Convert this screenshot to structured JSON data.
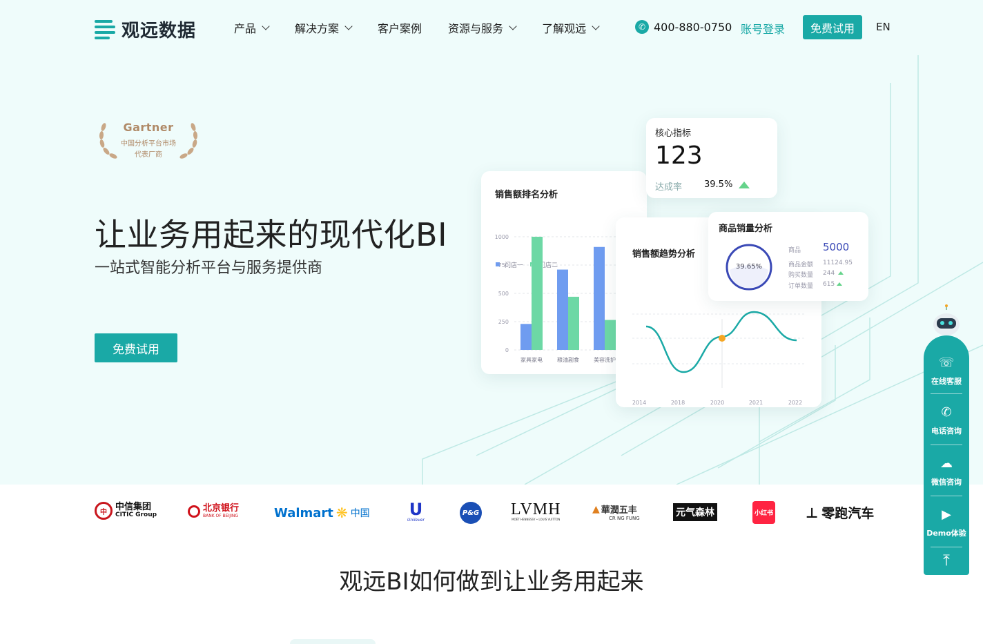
{
  "header": {
    "brand": "观远数据",
    "nav": [
      {
        "label": "产品",
        "has_dropdown": true
      },
      {
        "label": "解决方案",
        "has_dropdown": true
      },
      {
        "label": "客户案例",
        "has_dropdown": false
      },
      {
        "label": "资源与服务",
        "has_dropdown": true
      },
      {
        "label": "了解观远",
        "has_dropdown": true
      }
    ],
    "phone": "400-880-0750",
    "login": "账号登录",
    "trial": "免费试用",
    "lang": "EN"
  },
  "hero": {
    "badge": {
      "line1": "Gartner",
      "line2": "中国分析平台市场",
      "line3": "代表厂商"
    },
    "title": "让业务用起来的现代化BI",
    "subtitle": "一站式智能分析平台与服务提供商",
    "cta": "免费试用"
  },
  "colors": {
    "accent": "#1aa9a6",
    "bar_blue": "#6f9cf0",
    "bar_green": "#6dd8a5",
    "line": "#1aa9a6",
    "marker": "#f5a623",
    "ring": "#3a49b6",
    "up": "#65d38a"
  },
  "kpi_card": {
    "title": "核心指标",
    "value": "123",
    "rate_label": "达成率",
    "rate_value": "39.5%"
  },
  "sales_card": {
    "title": "商品销量分析",
    "ring_percent": "39.65%",
    "ring_fraction": 0.3965,
    "rows": [
      {
        "label": "商品",
        "value": "5000"
      },
      {
        "label": "商品金额",
        "value": "11124.95"
      },
      {
        "label": "购买数量",
        "value": "244"
      },
      {
        "label": "订单数量",
        "value": "615"
      }
    ]
  },
  "chart_data": [
    {
      "type": "bar",
      "title": "销售额排名分析",
      "categories": [
        "家具家电",
        "粮油副食",
        "美容洗护"
      ],
      "series": [
        {
          "name": "门店一",
          "values": [
            230,
            710,
            910
          ]
        },
        {
          "name": "门店二",
          "values": [
            1000,
            470,
            265
          ]
        }
      ],
      "ylim": [
        0,
        1000
      ],
      "yticks": [
        "0",
        "250",
        "500",
        "750",
        "1000"
      ],
      "grid": true,
      "legend": "top-left"
    },
    {
      "type": "line",
      "title": "销售额趋势分析",
      "x": [
        "2014",
        "2018",
        "2020",
        "2021",
        "2022"
      ],
      "series": [
        {
          "values": [
            0.65,
            0.05,
            0.6,
            0.9,
            0.6
          ]
        }
      ],
      "highlight_index": 2,
      "grid": true
    }
  ],
  "logos": [
    {
      "name": "citic",
      "text1": "中信集团",
      "text2": "CITIC Group"
    },
    {
      "name": "bank-of-beijing",
      "text1": "北京银行",
      "text2": "BANK OF BEIJING"
    },
    {
      "name": "walmart",
      "text1": "Walmart",
      "text2": "中国"
    },
    {
      "name": "unilever",
      "text1": "Unilever"
    },
    {
      "name": "pg",
      "text1": "P&G"
    },
    {
      "name": "lvmh",
      "text1": "LVMH",
      "text2": "MOËT HENNESSY • LOUIS VUITTON"
    },
    {
      "name": "cr-ng-fung",
      "text1": "華潤五丰",
      "text2": "CR NG FUNG"
    },
    {
      "name": "genki-forest",
      "text1": "元气森林"
    },
    {
      "name": "xiaohongshu",
      "text1": "小红书"
    },
    {
      "name": "leapmotor",
      "text1": "零跑汽车"
    }
  ],
  "section": {
    "title": "观远BI如何做到让业务用起来"
  },
  "side_widget": {
    "items": [
      {
        "label": "在线客服",
        "icon": "headset-icon"
      },
      {
        "label": "电话咨询",
        "icon": "phone-icon"
      },
      {
        "label": "微信咨询",
        "icon": "wechat-icon"
      },
      {
        "label": "Demo体验",
        "icon": "play-icon"
      }
    ],
    "top": "back-to-top-icon"
  }
}
